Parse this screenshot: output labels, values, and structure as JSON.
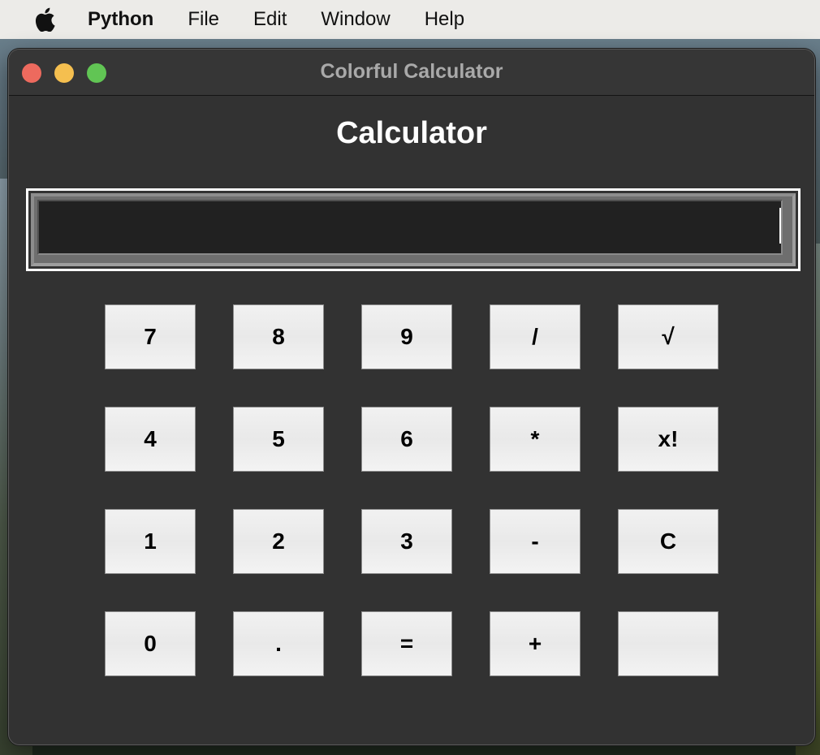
{
  "menubar": {
    "apple_icon": "apple-logo",
    "items": [
      "Python",
      "File",
      "Edit",
      "Window",
      "Help"
    ]
  },
  "window": {
    "title": "Colorful Calculator",
    "heading": "Calculator",
    "traffic_lights": {
      "close": "#ed6a5e",
      "minimize": "#f5bf4f",
      "zoom": "#61c554"
    }
  },
  "display": {
    "value": ""
  },
  "keys": [
    [
      "7",
      "8",
      "9",
      "/",
      "√"
    ],
    [
      "4",
      "5",
      "6",
      "*",
      "x!"
    ],
    [
      "1",
      "2",
      "3",
      "-",
      "C"
    ],
    [
      "0",
      ".",
      "=",
      "+",
      ""
    ]
  ],
  "colors": {
    "window_bg": "#323232",
    "heading_text": "#ffffff",
    "display_bg": "#212121",
    "key_bg": "#f0f0f0",
    "key_text": "#000000"
  }
}
